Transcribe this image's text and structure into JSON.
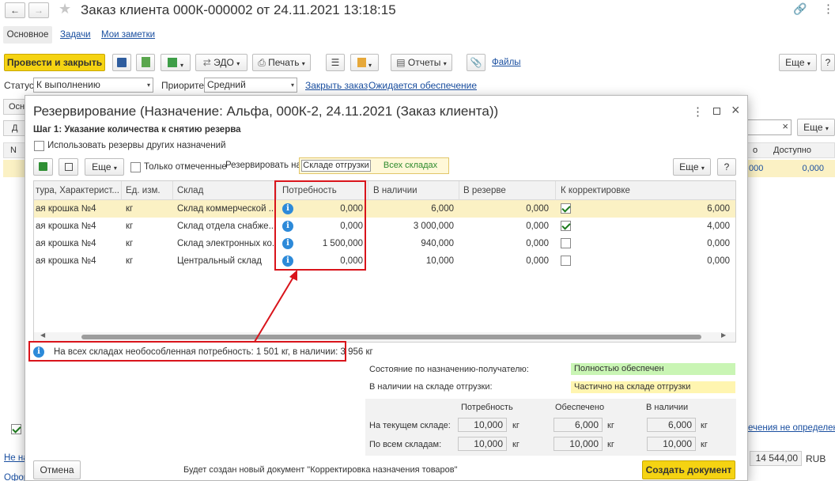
{
  "window": {
    "title": "Заказ клиента 000К-000002 от 24.11.2021 13:18:15",
    "tabs": [
      "Основное",
      "Задачи",
      "Мои заметки"
    ]
  },
  "toolbar": {
    "post_close": "Провести и закрыть",
    "edo": "ЭДО",
    "print": "Печать",
    "reports": "Отчеты",
    "files": "Файлы",
    "more": "Еще",
    "help": "?"
  },
  "status_bar": {
    "status_label": "Статус:",
    "status_value": "К выполнению",
    "priority_label": "Приоритет:",
    "priority_value": "Средний",
    "close_order": "Закрыть заказ",
    "awaiting": "Ожидается обеспечение"
  },
  "background": {
    "tab_partial": "Осн",
    "col_o": "о",
    "col_available": "Доступно",
    "val_1": "000",
    "val_2": "0,000",
    "more": "Еще",
    "clear": "×",
    "d_partial": "Д",
    "n_partial": "N",
    "link_right": "ечения не определена",
    "link_left1": "Не на",
    "link_left2": "Офор",
    "total": "14 544,00",
    "currency": "RUB"
  },
  "dialog": {
    "title": "Резервирование (Назначение: Альфа, 000К-2, 24.11.2021 (Заказ клиента))",
    "step": "Шаг 1: Указание количества к снятию резерва",
    "use_other_reserves": "Использовать резервы других назначений",
    "more": "Еще",
    "only_marked": "Только отмеченные",
    "reserve_on": "Резервировать на:",
    "reserve_options": [
      "Складе отгрузки",
      "Всех складах"
    ],
    "help": "?",
    "columns": [
      "тура, Характерист...",
      "Ед. изм.",
      "Склад",
      "Потребность",
      "В наличии",
      "В резерве",
      "К корректировке"
    ],
    "rows": [
      {
        "item": "ая крошка №4",
        "unit": "кг",
        "warehouse": "Склад коммерческой ...",
        "need": "0,000",
        "stock": "6,000",
        "reserve": "0,000",
        "checked": true,
        "correct": "6,000"
      },
      {
        "item": "ая крошка №4",
        "unit": "кг",
        "warehouse": "Склад отдела снабже...",
        "need": "0,000",
        "stock": "3 000,000",
        "reserve": "0,000",
        "checked": true,
        "correct": "4,000"
      },
      {
        "item": "ая крошка №4",
        "unit": "кг",
        "warehouse": "Склад электронных ко...",
        "need": "1 500,000",
        "stock": "940,000",
        "reserve": "0,000",
        "checked": false,
        "correct": "0,000"
      },
      {
        "item": "ая крошка №4",
        "unit": "кг",
        "warehouse": "Центральный склад",
        "need": "0,000",
        "stock": "10,000",
        "reserve": "0,000",
        "checked": false,
        "correct": "0,000"
      }
    ],
    "info_message": "На всех складах необособленная потребность: 1 501 кг, в наличии: 3 956 кг",
    "state_label": "Состояние по назначению-получателю:",
    "state_value": "Полностью обеспечен",
    "stock_label": "В наличии на складе отгрузки:",
    "stock_value": "Частично на складе отгрузки",
    "summary": {
      "headers": [
        "Потребность",
        "Обеспечено",
        "В наличии"
      ],
      "rows": [
        {
          "label": "На текущем складе:",
          "need": "10,000",
          "provided": "6,000",
          "available": "6,000",
          "unit": "кг"
        },
        {
          "label": "По всем складам:",
          "need": "10,000",
          "provided": "10,000",
          "available": "10,000",
          "unit": "кг"
        }
      ]
    },
    "cancel": "Отмена",
    "footer_note": "Будет создан новый документ \"Корректировка назначения товаров\"",
    "create": "Создать документ",
    "colors": {
      "green": "#c9f5b4",
      "yellow": "#fff5b0",
      "highlight_row": "#fbf1c4",
      "annotation": "#d9141b"
    }
  }
}
